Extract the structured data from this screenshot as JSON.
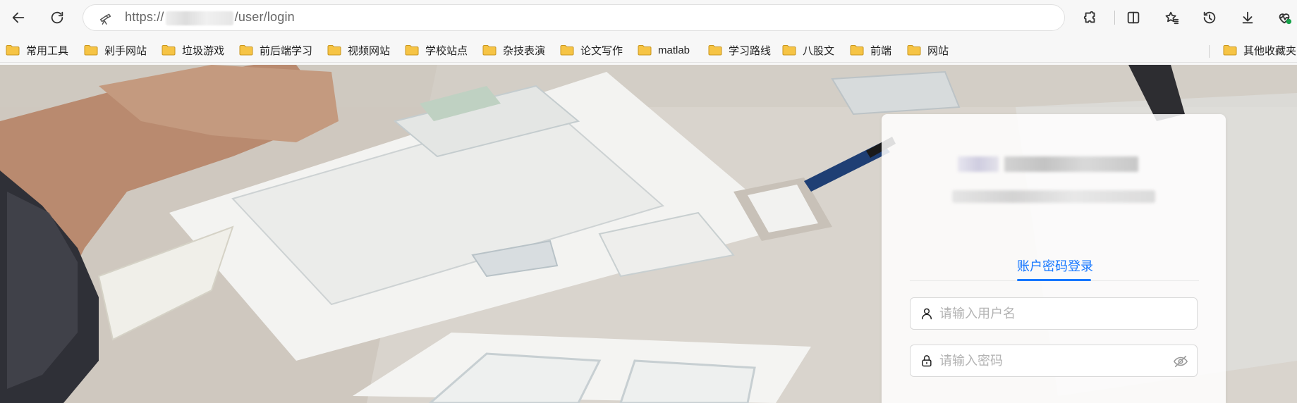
{
  "browser": {
    "url_prefix": "https://",
    "url_suffix": "/user/login",
    "icons": [
      "back-icon",
      "refresh-icon",
      "site-info-icon",
      "extensions-icon",
      "split-screen-icon",
      "favorites-icon",
      "history-icon",
      "download-icon",
      "browser-essentials-icon"
    ]
  },
  "bookmarks": {
    "items": [
      {
        "label": "常用工具"
      },
      {
        "label": "剁手网站"
      },
      {
        "label": "垃圾游戏"
      },
      {
        "label": "前后端学习"
      },
      {
        "label": "视频网站"
      },
      {
        "label": "学校站点"
      },
      {
        "label": "杂技表演"
      },
      {
        "label": "论文写作"
      },
      {
        "label": "matlab"
      },
      {
        "label": "学习路线"
      },
      {
        "label": "八股文"
      },
      {
        "label": "前端"
      },
      {
        "label": "网站"
      }
    ],
    "other_label": "其他收藏夹"
  },
  "login": {
    "tab_label": "账户密码登录",
    "username": {
      "placeholder": "请输入用户名",
      "value": ""
    },
    "password": {
      "placeholder": "请输入密码",
      "value": ""
    }
  },
  "colors": {
    "accent": "#1677ff",
    "folder": "#f6c445"
  }
}
